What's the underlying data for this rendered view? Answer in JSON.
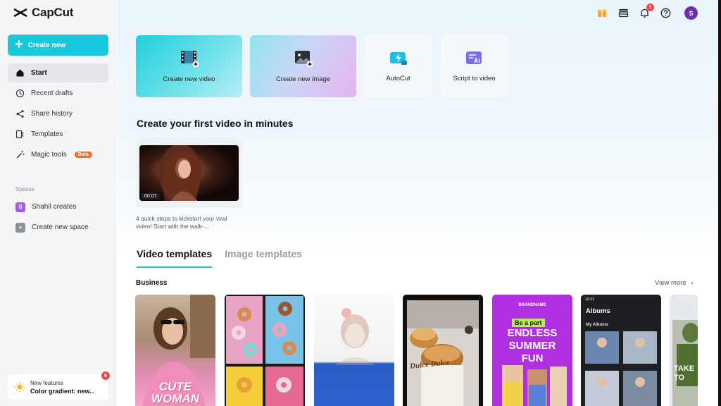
{
  "app": {
    "name": "CapCut"
  },
  "sidebar": {
    "create_label": "Create new",
    "nav": [
      {
        "label": "Start",
        "icon": "home-icon"
      },
      {
        "label": "Recent drafts",
        "icon": "clock-icon"
      },
      {
        "label": "Share history",
        "icon": "share-icon"
      },
      {
        "label": "Templates",
        "icon": "templates-icon"
      },
      {
        "label": "Magic tools",
        "icon": "magic-wand-icon",
        "badge": "Beta"
      }
    ],
    "spaces_label": "Spaces",
    "spaces": [
      {
        "initial": "S",
        "label": "Shahil creates"
      },
      {
        "initial": "+",
        "label": "Create new space"
      }
    ],
    "features": {
      "small": "New features",
      "main": "Color gradient: new...",
      "badge": "6"
    }
  },
  "topbar": {
    "notifications": "1",
    "avatar_initial": "S"
  },
  "quick_actions": [
    {
      "label": "Create new video",
      "icon": "film-add-icon"
    },
    {
      "label": "Create new image",
      "icon": "image-add-icon"
    },
    {
      "label": "AutoCut",
      "icon": "autocut-icon"
    },
    {
      "label": "Script to video",
      "icon": "ai-script-icon"
    }
  ],
  "first_video": {
    "title": "Create your first video in minutes",
    "duration": "00:07",
    "description": "4 quick steps to kickstart your viral video! Start with the walk-..."
  },
  "templates": {
    "tabs": [
      "Video templates",
      "Image templates"
    ],
    "category": "Business",
    "view_more": "View more",
    "items": [
      {
        "overlay": "CUTE WOMAN"
      },
      {
        "overlay": ""
      },
      {
        "overlay": ""
      },
      {
        "overlay": "Dulce Dulce"
      },
      {
        "brand": "BRANDNAME",
        "tag": "Be a part",
        "overlay": "ENDLESS SUMMER FUN"
      },
      {
        "time": "12:31",
        "title": "Albums",
        "subtitle": "My Albums"
      },
      {
        "overlay": "TAKE TO"
      }
    ]
  },
  "colors": {
    "accent": "#18c8dd",
    "beta": "#fa6e21",
    "notification": "#f04848",
    "avatar": "#6b2fae"
  }
}
